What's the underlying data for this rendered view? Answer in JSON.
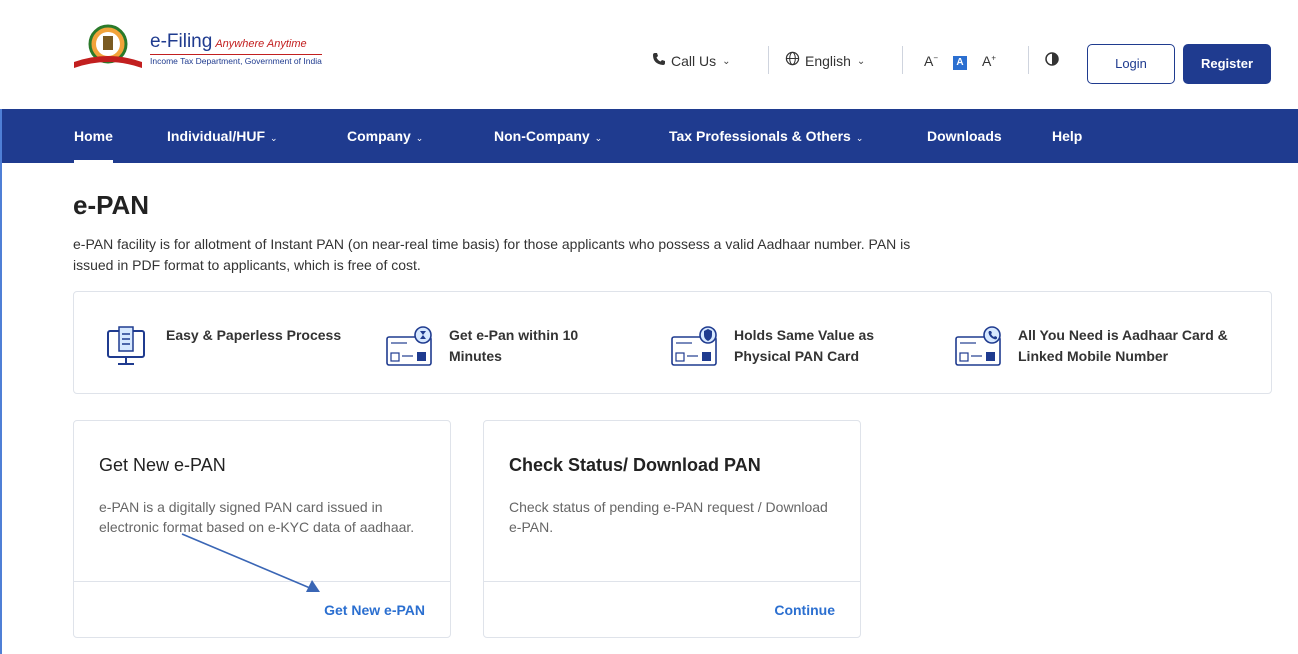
{
  "header": {
    "logo_title": "e-Filing",
    "logo_tagline": "Anywhere Anytime",
    "logo_subtitle": "Income Tax Department, Government of India",
    "call_label": "Call Us",
    "language": "English",
    "font_decrease": "A",
    "font_normal": "A",
    "font_increase": "A",
    "login_label": "Login",
    "register_label": "Register"
  },
  "nav": {
    "items": [
      {
        "label": "Home"
      },
      {
        "label": "Individual/HUF"
      },
      {
        "label": "Company"
      },
      {
        "label": "Non-Company"
      },
      {
        "label": "Tax Professionals & Others"
      },
      {
        "label": "Downloads"
      },
      {
        "label": "Help"
      }
    ]
  },
  "page": {
    "title": "e-PAN",
    "description": "e-PAN facility is for allotment of Instant PAN (on near-real time basis) for those applicants who possess a valid Aadhaar number. PAN is issued in PDF format to applicants, which is free of cost."
  },
  "features": [
    {
      "line1": "Easy & Paperless Process",
      "line2": ""
    },
    {
      "line1": "Get e-Pan within 10",
      "line2": "Minutes"
    },
    {
      "line1": "Holds Same Value as",
      "line2": "Physical PAN Card"
    },
    {
      "line1": "All You Need is Aadhaar Card &",
      "line2": "Linked Mobile Number"
    }
  ],
  "cards": [
    {
      "title": "Get New e-PAN",
      "body": "e-PAN is a digitally signed PAN card issued in electronic format based on e-KYC data of aadhaar.",
      "action": "Get New e-PAN"
    },
    {
      "title": "Check Status/ Download PAN",
      "body": "Check status of pending e-PAN request / Download e-PAN.",
      "action": "Continue"
    }
  ],
  "colors": {
    "brand_blue": "#1f3b8f",
    "link_blue": "#2b6fd0",
    "accent_red": "#c21f1f"
  }
}
